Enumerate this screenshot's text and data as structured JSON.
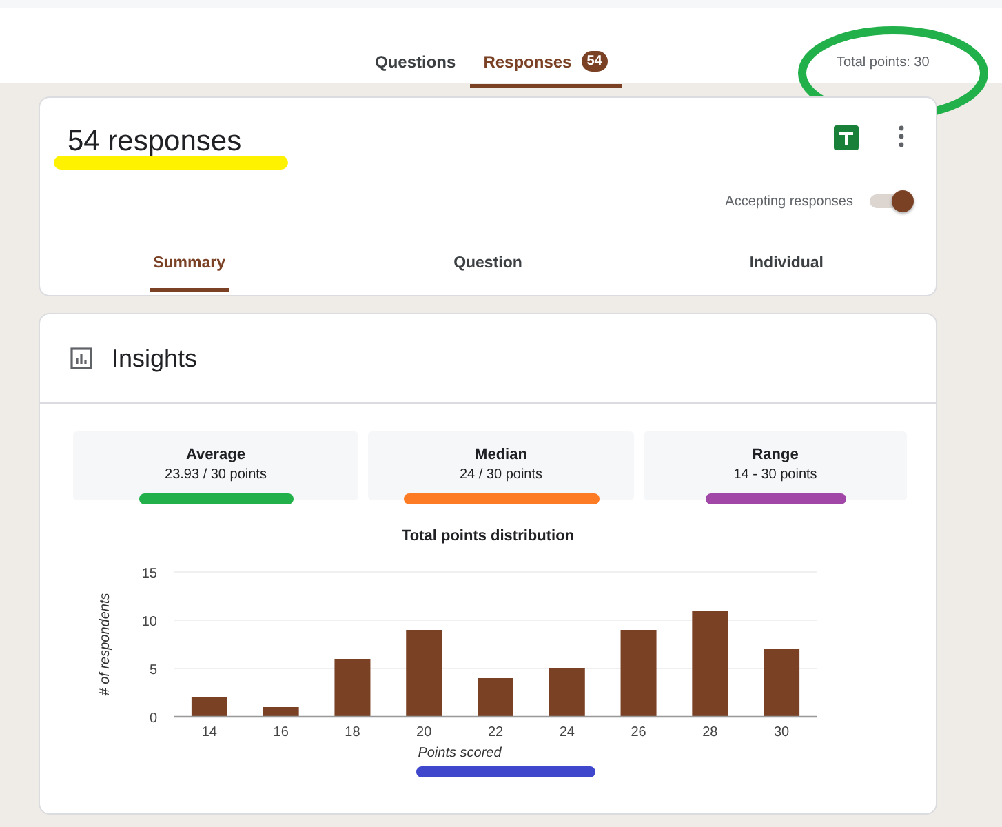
{
  "top_tabs": [
    {
      "label": "Questions",
      "selected": false
    },
    {
      "label": "Responses",
      "selected": true,
      "badge": "54"
    }
  ],
  "total_points": {
    "text": "Total points: 30",
    "mark": {
      "kind": "ellipse",
      "color": "#22b04a"
    }
  },
  "summary": {
    "title": "54 responses",
    "title_mark": {
      "kind": "underline",
      "color": "#fff200"
    },
    "accepting": {
      "label": "Accepting responses",
      "on": true
    },
    "tabs": [
      {
        "label": "Summary",
        "selected": true
      },
      {
        "label": "Question",
        "selected": false
      },
      {
        "label": "Individual",
        "selected": false
      }
    ]
  },
  "insights": {
    "title": "Insights",
    "stats": [
      {
        "label": "Average",
        "value": "23.93 / 30 points",
        "mark": {
          "kind": "underline",
          "color": "#22b04a"
        }
      },
      {
        "label": "Median",
        "value": "24 / 30 points",
        "mark": {
          "kind": "underline",
          "color": "#fd7b24"
        }
      },
      {
        "label": "Range",
        "value": "14 - 30 points",
        "mark": {
          "kind": "underline",
          "color": "#a047a8"
        }
      }
    ],
    "chart_data": {
      "type": "bar",
      "title": "Total points distribution",
      "xlabel": "Points scored",
      "ylabel": "# of respondents",
      "categories": [
        "14",
        "16",
        "18",
        "20",
        "22",
        "24",
        "26",
        "28",
        "30"
      ],
      "series": [
        {
          "color": "#7a4125",
          "values": [
            2,
            1,
            6,
            9,
            4,
            5,
            9,
            11,
            7
          ]
        }
      ],
      "ylim": [
        0,
        15
      ],
      "yticks": [
        0,
        5,
        10,
        15
      ]
    },
    "xlabel_mark": {
      "kind": "underline",
      "color": "#3f48cc"
    }
  }
}
